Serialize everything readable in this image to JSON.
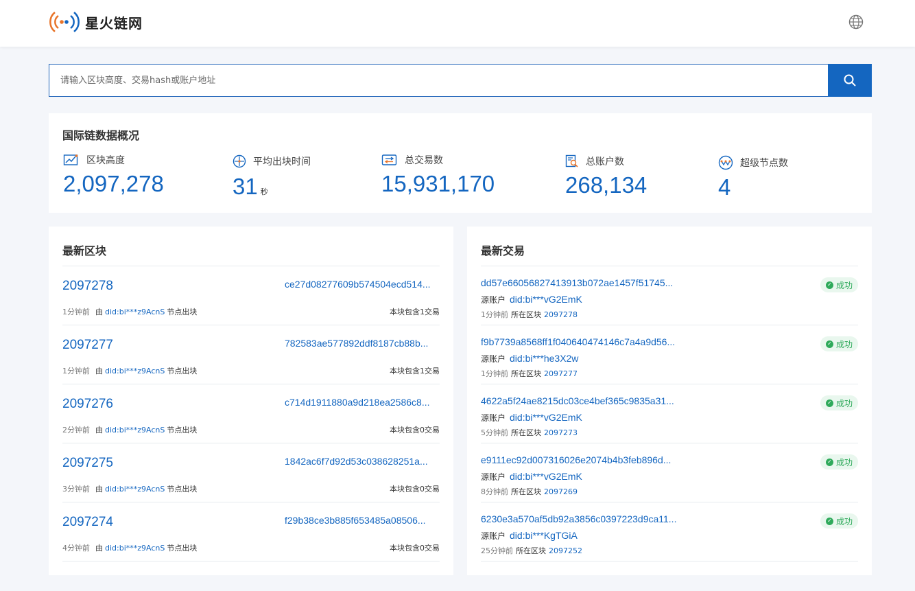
{
  "header": {
    "logo_text": "星火链网"
  },
  "search": {
    "placeholder": "请输入区块高度、交易hash或账户地址"
  },
  "overview": {
    "title": "国际链数据概况",
    "stats": [
      {
        "label": "区块高度",
        "value": "2,097,278",
        "unit": "",
        "icon": "chart-icon"
      },
      {
        "label": "平均出块时间",
        "value": "31",
        "unit": "秒",
        "icon": "clock-icon"
      },
      {
        "label": "总交易数",
        "value": "15,931,170",
        "unit": "",
        "icon": "transaction-icon"
      },
      {
        "label": "总账户数",
        "value": "268,134",
        "unit": "",
        "icon": "account-icon"
      },
      {
        "label": "超级节点数",
        "value": "4",
        "unit": "",
        "icon": "node-icon"
      }
    ]
  },
  "blocks": {
    "title": "最新区块",
    "by": "由",
    "suffix": "节点出块",
    "items": [
      {
        "height": "2097278",
        "hash": "ce27d08277609b574504ecd514...",
        "time": "1分钟前",
        "node": "did:bi***z9AcnS",
        "count": "本块包含1交易"
      },
      {
        "height": "2097277",
        "hash": "782583ae577892ddf8187cb88b...",
        "time": "1分钟前",
        "node": "did:bi***z9AcnS",
        "count": "本块包含1交易"
      },
      {
        "height": "2097276",
        "hash": "c714d1911880a9d218ea2586c8...",
        "time": "2分钟前",
        "node": "did:bi***z9AcnS",
        "count": "本块包含0交易"
      },
      {
        "height": "2097275",
        "hash": "1842ac6f7d92d53c038628251a...",
        "time": "3分钟前",
        "node": "did:bi***z9AcnS",
        "count": "本块包含0交易"
      },
      {
        "height": "2097274",
        "hash": "f29b38ce3b885f653485a08506...",
        "time": "4分钟前",
        "node": "did:bi***z9AcnS",
        "count": "本块包含0交易"
      }
    ]
  },
  "transactions": {
    "title": "最新交易",
    "from_label": "源账户",
    "in_block_label": "所在区块",
    "items": [
      {
        "hash": "dd57e66056827413913b072ae1457f51745...",
        "from": "did:bi***vG2EmK",
        "time": "1分钟前",
        "block": "2097278",
        "status": "成功"
      },
      {
        "hash": "f9b7739a8568ff1f040640474146c7a4a9d56...",
        "from": "did:bi***he3X2w",
        "time": "1分钟前",
        "block": "2097277",
        "status": "成功"
      },
      {
        "hash": "4622a5f24ae8215dc03ce4bef365c9835a31...",
        "from": "did:bi***vG2EmK",
        "time": "5分钟前",
        "block": "2097273",
        "status": "成功"
      },
      {
        "hash": "e9111ec92d007316026e2074b4b3feb896d...",
        "from": "did:bi***vG2EmK",
        "time": "8分钟前",
        "block": "2097269",
        "status": "成功"
      },
      {
        "hash": "6230e3a570af5db92a3856c0397223d9ca11...",
        "from": "did:bi***KgTGiA",
        "time": "25分钟前",
        "block": "2097252",
        "status": "成功"
      }
    ]
  },
  "colors": {
    "primary": "#1466c0",
    "success": "#2faa5b",
    "background": "#f4f6fa"
  }
}
